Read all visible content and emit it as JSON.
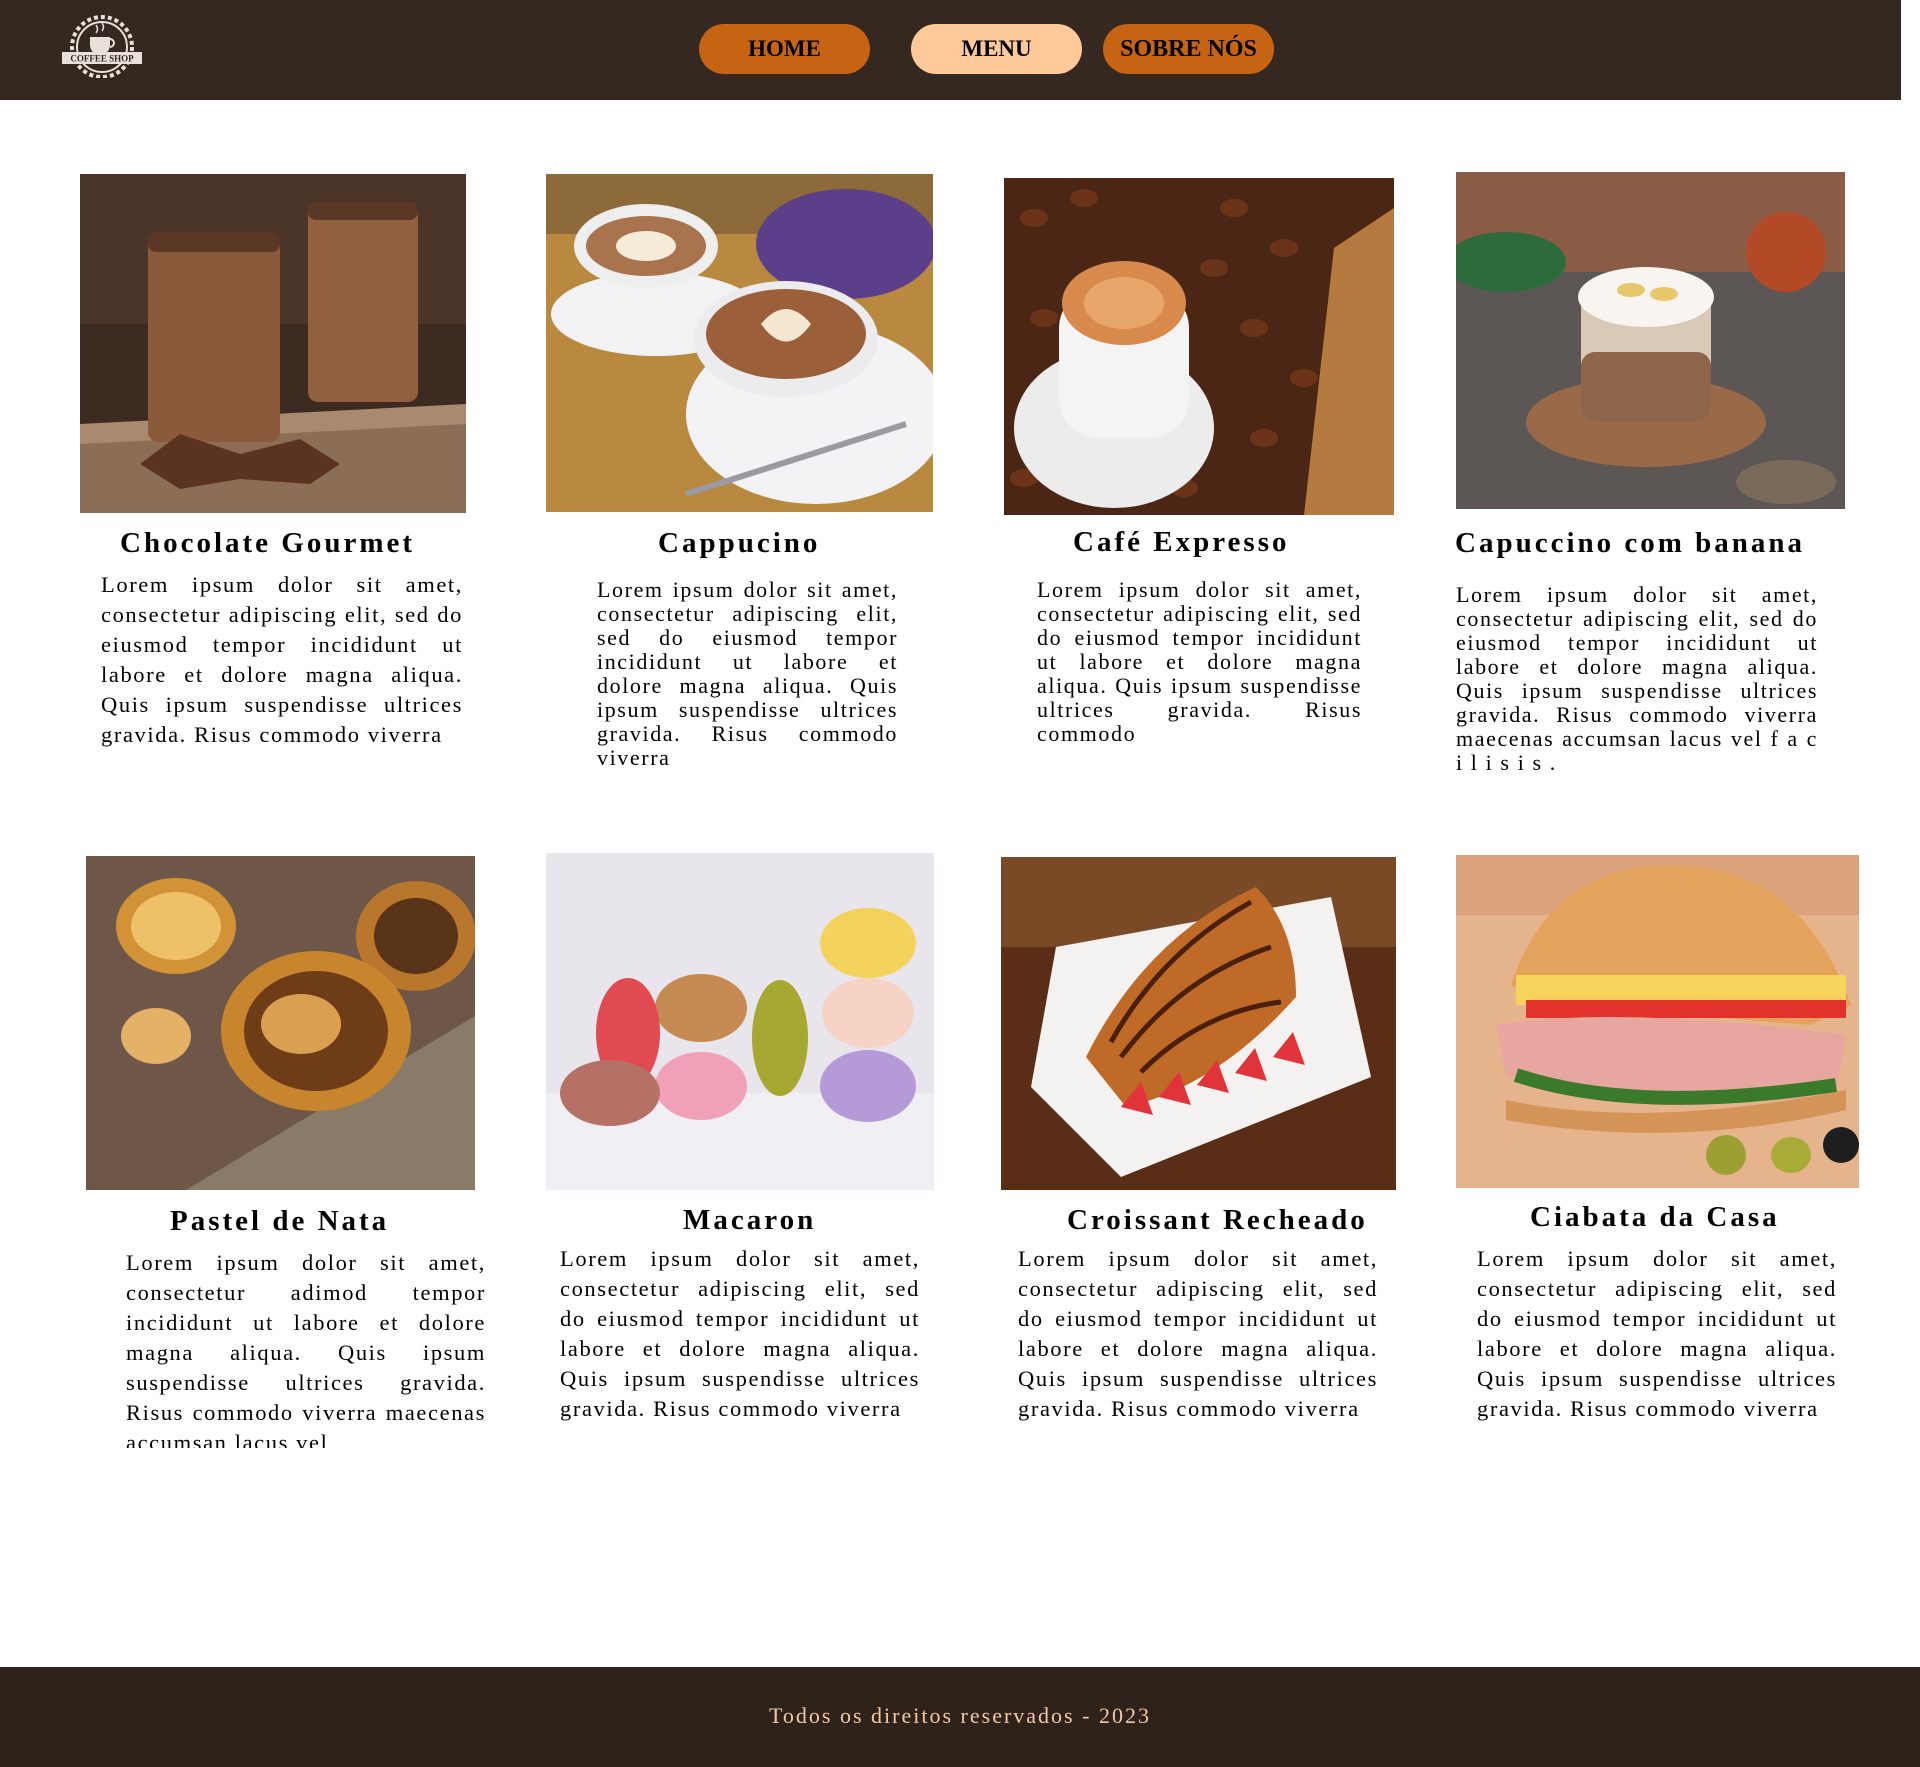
{
  "header": {
    "logo_text": "COFFEE SHOP",
    "logo_icon": "coffee-cup-icon",
    "nav": {
      "home": "HOME",
      "menu": "MENU",
      "about": "SOBRE NÓS"
    },
    "colors": {
      "bar": "#342820",
      "active": "#ffc999",
      "inactive": "#c66414"
    }
  },
  "menu": {
    "items": [
      {
        "title": "Chocolate Gourmet",
        "description": "Lorem ipsum dolor sit amet, consectetur adipiscing elit, sed do eiusmod tempor incididunt ut labore et dolore magna aliqua. Quis ipsum suspendisse ultrices gravida. Risus commodo viverra"
      },
      {
        "title": "Cappucino",
        "description": "Lorem ipsum dolor sit amet, consectetur adipiscing elit, sed do eiusmod tempor incididunt ut labore et dolore magna aliqua. Quis ipsum suspendisse ultrices gravida. Risus commodo viverra"
      },
      {
        "title": "Café Expresso",
        "description": "Lorem ipsum dolor sit amet, consectetur adipiscing elit, sed do eiusmod tempor incididunt ut labore et dolore magna aliqua. Quis ipsum suspendisse ultrices gravida. Risus commodo"
      },
      {
        "title": "Capuccino com banana",
        "description": "Lorem ipsum dolor sit amet, consectetur adipiscing elit, sed do eiusmod tempor incididunt ut labore et dolore magna aliqua. Quis ipsum suspendisse ultrices gravida. Risus commodo viverra maecenas accumsan lacus vel f a c i l i s i s ."
      },
      {
        "title": "Pastel de Nata",
        "description": "Lorem ipsum dolor sit amet, consectetur adimod tempor incididunt ut labore et dolore magna aliqua. Quis ipsum suspendisse ultrices gravida. Risus commodo viverra maecenas accumsan lacus vel"
      },
      {
        "title": "Macaron",
        "description": "Lorem ipsum dolor sit amet, consectetur adipiscing elit, sed do eiusmod tempor incididunt ut labore et dolore magna aliqua. Quis ipsum suspendisse ultrices gravida. Risus commodo viverra"
      },
      {
        "title": "Croissant Recheado",
        "description": "Lorem ipsum dolor sit amet, consectetur adipiscing elit, sed do eiusmod tempor incididunt ut labore et dolore magna aliqua. Quis ipsum suspendisse ultrices gravida. Risus commodo viverra"
      },
      {
        "title": "Ciabata da Casa",
        "description": "Lorem ipsum dolor sit amet, consectetur adipiscing elit, sed do eiusmod tempor incididunt ut labore et dolore magna aliqua. Quis ipsum suspendisse ultrices gravida. Risus commodo viverra"
      }
    ]
  },
  "footer": {
    "text": "Todos os direitos reservados - 2023"
  }
}
